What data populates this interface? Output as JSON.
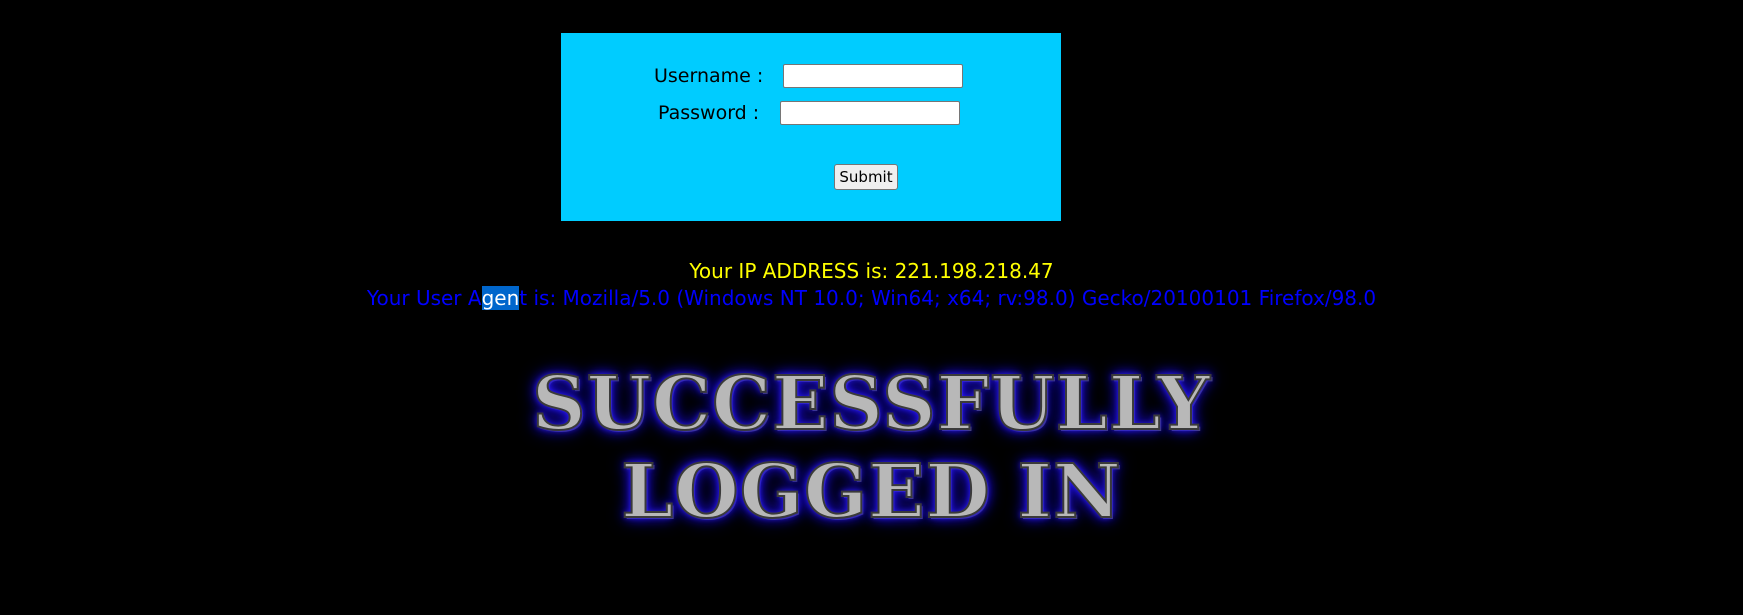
{
  "login_form": {
    "username_label": "Username :",
    "password_label": "Password :",
    "username_value": "",
    "password_value": "",
    "submit_label": "Submit"
  },
  "info": {
    "ip_text": "Your IP ADDRESS is: 221.198.218.47",
    "user_agent_before": "Your User A",
    "user_agent_selected": "gen",
    "user_agent_after": "t is: Mozilla/5.0 (Windows NT 10.0; Win64; x64; rv:98.0) Gecko/20100101 Firefox/98.0"
  },
  "banner": {
    "line1": "SUCCESSFULLY",
    "line2": "LOGGED IN"
  },
  "colors": {
    "background": "#000000",
    "form_background": "#00ccff",
    "ip_text": "#ffff00",
    "user_agent_text": "#0000ff",
    "selection": "#0066cc"
  }
}
